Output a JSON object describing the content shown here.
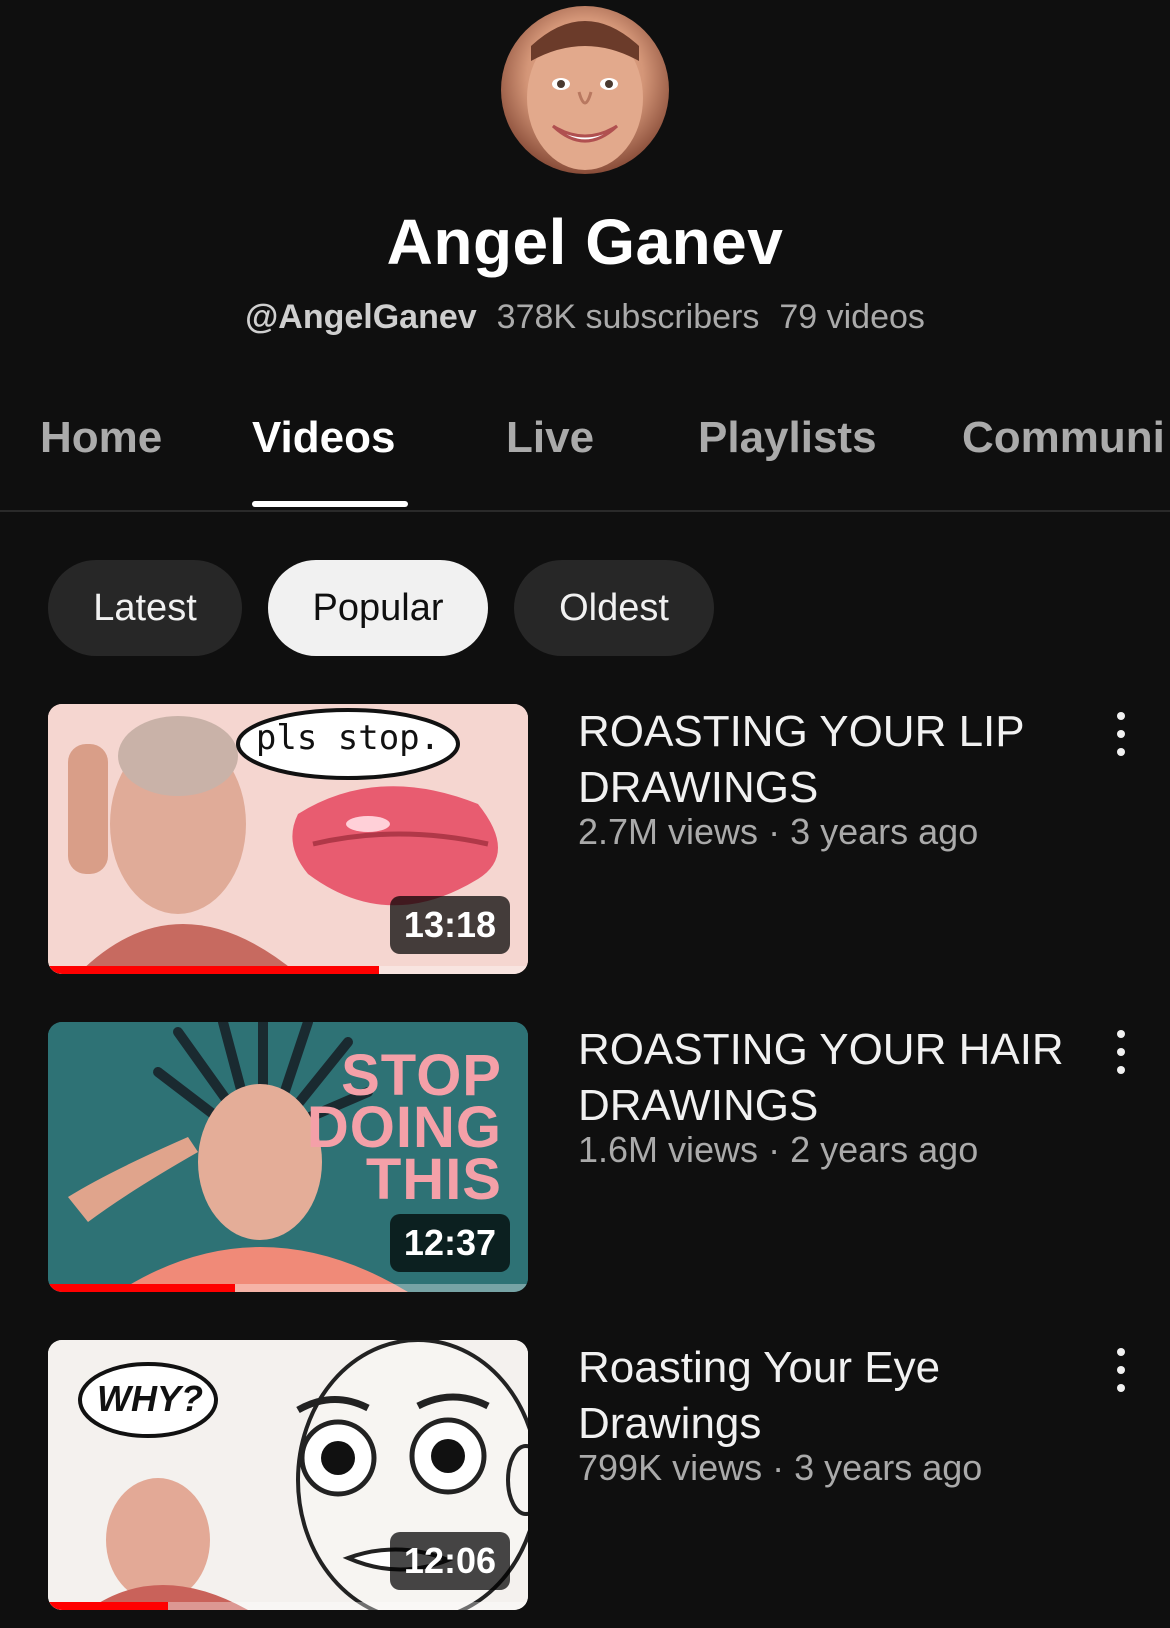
{
  "channel": {
    "name": "Angel Ganev",
    "handle": "@AngelGanev",
    "subscribers": "378K subscribers",
    "video_count": "79 videos"
  },
  "tabs": [
    {
      "label": "Home",
      "active": false
    },
    {
      "label": "Videos",
      "active": true
    },
    {
      "label": "Live",
      "active": false
    },
    {
      "label": "Playlists",
      "active": false
    },
    {
      "label": "Communi",
      "active": false
    }
  ],
  "sort_chips": [
    {
      "label": "Latest",
      "selected": false
    },
    {
      "label": "Popular",
      "selected": true
    },
    {
      "label": "Oldest",
      "selected": false
    }
  ],
  "videos": [
    {
      "title": "ROASTING YOUR LIP DRAWINGS",
      "views": "2.7M views",
      "age": "3 years ago",
      "duration": "13:18",
      "watched_fraction": 0.69,
      "thumbnail_text": "pls stop."
    },
    {
      "title": "ROASTING YOUR HAIR DRAWINGS",
      "views": "1.6M views",
      "age": "2 years ago",
      "duration": "12:37",
      "watched_fraction": 0.39,
      "thumbnail_text": [
        "STOP",
        "DOING",
        "THIS"
      ]
    },
    {
      "title": "Roasting Your Eye Drawings",
      "views": "799K views",
      "age": "3 years ago",
      "duration": "12:06",
      "watched_fraction": 0.25,
      "thumbnail_text": "WHY?"
    }
  ],
  "meta_separator": "·",
  "colors": {
    "background": "#0f0f0f",
    "progress": "#ff0000",
    "chip": "#272727",
    "chip_selected": "#f1f1f1",
    "thumbnail_title_pink": "#f4a0a8",
    "thumbnail_teal": "#2e7275"
  }
}
